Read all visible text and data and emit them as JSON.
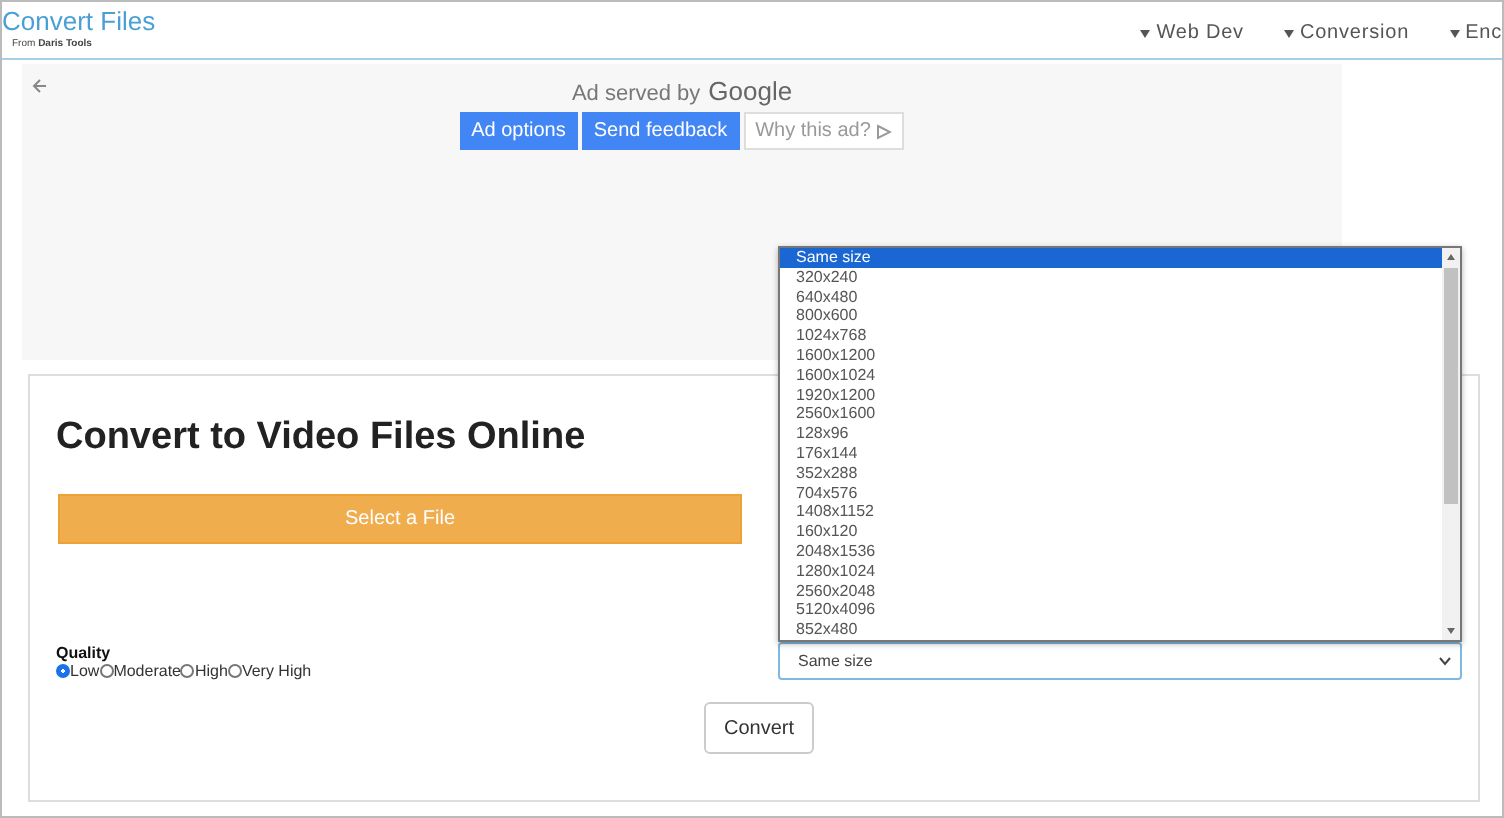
{
  "header": {
    "title": "Convert Files",
    "subtitle_prefix": "From",
    "subtitle_brand": "Daris Tools",
    "nav": [
      "Web Dev",
      "Conversion",
      "Enc"
    ]
  },
  "ad": {
    "served_by": "Ad served by",
    "brand": "Google",
    "buttons": [
      {
        "label": "Ad options",
        "kind": "primary"
      },
      {
        "label": "Send feedback",
        "kind": "primary"
      },
      {
        "label": "Why this ad?",
        "kind": "plain"
      }
    ]
  },
  "converter": {
    "title": "Convert to Video Files Online",
    "file_button": "Select a File",
    "quality_label": "Quality",
    "quality_options": [
      {
        "label": "Low",
        "selected": true
      },
      {
        "label": "Moderate",
        "selected": false
      },
      {
        "label": "High",
        "selected": false
      },
      {
        "label": "Very High",
        "selected": false
      }
    ],
    "size_select": {
      "value": "Same size",
      "expanded": true,
      "options": [
        {
          "label": "Same size",
          "selected": true
        },
        {
          "label": "320x240",
          "selected": false
        },
        {
          "label": "640x480",
          "selected": false
        },
        {
          "label": "800x600",
          "selected": false
        },
        {
          "label": "1024x768",
          "selected": false
        },
        {
          "label": "1600x1200",
          "selected": false
        },
        {
          "label": "1600x1024",
          "selected": false
        },
        {
          "label": "1920x1200",
          "selected": false
        },
        {
          "label": "2560x1600",
          "selected": false
        },
        {
          "label": "128x96",
          "selected": false
        },
        {
          "label": "176x144",
          "selected": false
        },
        {
          "label": "352x288",
          "selected": false
        },
        {
          "label": "704x576",
          "selected": false
        },
        {
          "label": "1408x1152",
          "selected": false
        },
        {
          "label": "160x120",
          "selected": false
        },
        {
          "label": "2048x1536",
          "selected": false
        },
        {
          "label": "1280x1024",
          "selected": false
        },
        {
          "label": "2560x2048",
          "selected": false
        },
        {
          "label": "5120x4096",
          "selected": false
        },
        {
          "label": "852x480",
          "selected": false
        }
      ]
    },
    "convert_button": "Convert"
  }
}
